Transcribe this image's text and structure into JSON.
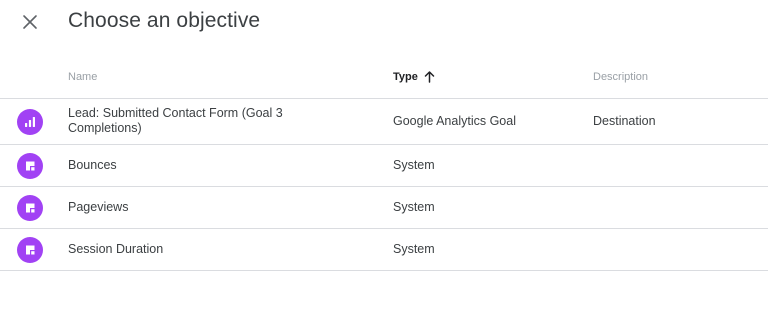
{
  "dialog": {
    "title": "Choose an objective"
  },
  "table": {
    "headers": {
      "name": "Name",
      "type": "Type",
      "description": "Description"
    },
    "sort": {
      "column": "type",
      "direction": "ascending",
      "icon": "arrow-up-icon"
    },
    "rows": [
      {
        "icon": "analytics-goal-icon",
        "name": "Lead: Submitted Contact Form (Goal 3 Completions)",
        "type": "Google Analytics Goal",
        "description": "Destination"
      },
      {
        "icon": "system-objective-icon",
        "name": "Bounces",
        "type": "System",
        "description": ""
      },
      {
        "icon": "system-objective-icon",
        "name": "Pageviews",
        "type": "System",
        "description": ""
      },
      {
        "icon": "system-objective-icon",
        "name": "Session Duration",
        "type": "System",
        "description": ""
      }
    ]
  },
  "colors": {
    "icon_bg": "#a142f4",
    "divider": "#dadce0",
    "header_text": "#9aa0a6"
  }
}
